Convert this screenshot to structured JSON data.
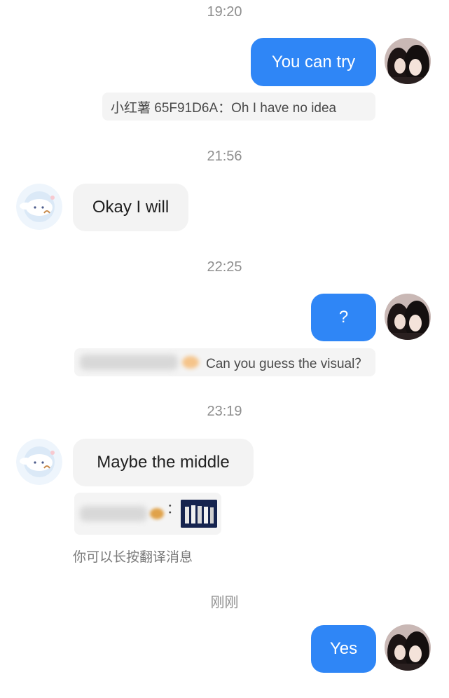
{
  "colors": {
    "outgoing_bubble": "#2f86f6",
    "incoming_bubble": "#f3f3f3",
    "quote_bg": "#f4f4f4",
    "timestamp_text": "#8e8e8e"
  },
  "messages": {
    "timestamp_1": "19:20",
    "out_1": "You can try",
    "quote_1": "小红薯 65F91D6A：Oh I have no idea",
    "timestamp_2": "21:56",
    "in_1": "Okay I will",
    "timestamp_3": "22:25",
    "out_2": "?",
    "quote_2_text": "Can you guess the visual？",
    "timestamp_4": "23:19",
    "in_2": "Maybe the middle",
    "quote_3_colon": "：",
    "translate_hint": "你可以长按翻译消息",
    "timestamp_5": "刚刚",
    "out_3": "Yes"
  },
  "icons": {
    "self_avatar": "girls-selfie-avatar-icon",
    "other_avatar": "cinnamoroll-avatar-icon",
    "sender_emoji": "sweet-potato-icon"
  }
}
